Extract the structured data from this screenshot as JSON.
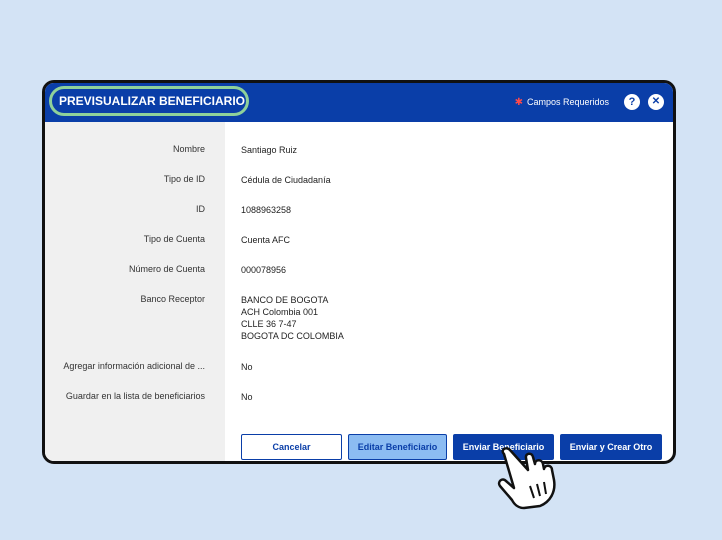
{
  "header": {
    "title": "PREVISUALIZAR BENEFICIARIO",
    "required_label": "Campos Requeridos",
    "help_symbol": "?",
    "close_symbol": "✕"
  },
  "fields": [
    {
      "label": "Nombre",
      "value": [
        "Santiago Ruiz"
      ]
    },
    {
      "label": "Tipo de ID",
      "value": [
        "Cédula de Ciudadanía"
      ]
    },
    {
      "label": "ID",
      "value": [
        "1088963258"
      ]
    },
    {
      "label": "Tipo de Cuenta",
      "value": [
        "Cuenta AFC"
      ]
    },
    {
      "label": "Número de Cuenta",
      "value": [
        "000078956"
      ]
    },
    {
      "label": "Banco Receptor",
      "value": [
        "BANCO DE BOGOTA",
        "ACH Colombia 001",
        "CLLE 36 7-47",
        "BOGOTA DC COLOMBIA"
      ]
    },
    {
      "label": "Agregar información adicional de ...",
      "value": [
        "No"
      ]
    },
    {
      "label": "Guardar en la lista de beneficiarios",
      "value": [
        "No"
      ]
    }
  ],
  "buttons": {
    "cancel": "Cancelar",
    "edit": "Editar Beneficiario",
    "send": "Enviar Beneficiario",
    "send_create": "Enviar y Crear Otro"
  },
  "colors": {
    "header": "#0a3ea8",
    "highlight": "#8fd19a",
    "background": "#d3e3f5"
  },
  "icons": {
    "required": "asterisk-icon",
    "help": "help-icon",
    "close": "close-icon",
    "cursor": "hand-pointer-icon"
  }
}
